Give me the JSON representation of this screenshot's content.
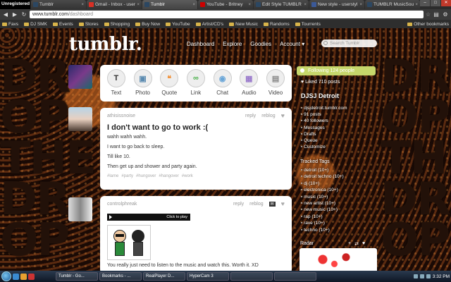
{
  "browser": {
    "hypercam_title": "Unregistered HyperCam 3",
    "tabs": [
      {
        "label": "Tumblr",
        "color": "#2c4762",
        "active": false
      },
      {
        "label": "Gmail - Inbox - userst",
        "color": "#d93025",
        "active": false
      },
      {
        "label": "Tumblr",
        "color": "#2c4762",
        "active": true
      },
      {
        "label": "YouTube - Britney",
        "color": "#cc0000",
        "active": false
      },
      {
        "label": "Edit Style TUMBLR",
        "color": "#2c4762",
        "active": false
      },
      {
        "label": "New style - userstyl",
        "color": "#3b5998",
        "active": false
      },
      {
        "label": "TUMBLR MusicSoun",
        "color": "#2c4762",
        "active": false
      }
    ],
    "url_host": "www.tumblr.com",
    "url_path": "/dashboard",
    "bookmarks": [
      "Favs",
      "DJ SMK",
      "Events",
      "Stores",
      "Shopping",
      "Buy Now",
      "YouTube",
      "Artist/CD's",
      "New Music",
      "Randoms",
      "Tourrents"
    ],
    "other_bookmarks": "Other bookmarks"
  },
  "tumblr": {
    "logo": "tumblr.",
    "nav": [
      "Dashboard",
      "Explore",
      "Goodies",
      "Account ▾"
    ],
    "search_placeholder": "Search Tumblr",
    "background_words": "DROP THE DROP THE DROP"
  },
  "post_types": [
    {
      "label": "Text",
      "icon": "text-icon",
      "glyph": "T",
      "color": "#333"
    },
    {
      "label": "Photo",
      "icon": "photo-icon",
      "glyph": "▣",
      "color": "#5a8ab0"
    },
    {
      "label": "Quote",
      "icon": "quote-icon",
      "glyph": "❝",
      "color": "#f0913a"
    },
    {
      "label": "Link",
      "icon": "link-icon",
      "glyph": "∞",
      "color": "#4ab04a"
    },
    {
      "label": "Chat",
      "icon": "chat-icon",
      "glyph": "◉",
      "color": "#6aa6d8"
    },
    {
      "label": "Audio",
      "icon": "audio-icon",
      "glyph": "▦",
      "color": "#9a7acc"
    },
    {
      "label": "Video",
      "icon": "video-icon",
      "glyph": "▤",
      "color": "#888"
    }
  ],
  "posts": [
    {
      "author": "athisissnoise",
      "reply": "reply",
      "reblog": "reblog",
      "title": "I don't want to go to work :(",
      "lines": [
        "wahh wahh wahh.",
        "I want to go back to sleep.",
        "Till like 10.",
        "Then get up and shower and party again."
      ],
      "tags": [
        "#lame",
        "#party",
        "#hungover",
        "#hangover",
        "#work"
      ]
    },
    {
      "author": "controlphreak",
      "reply": "reply",
      "reblog": "reblog",
      "player_label": "Click to play",
      "text": "You really just need to listen to the music and watch this.  Worth it. XD"
    }
  ],
  "sidebar": {
    "following": "Following 124 people",
    "liked": "Liked 710 posts",
    "blog_name": "DJSJ Detroit",
    "blog_items": [
      "djsjdetroit.tumblr.com",
      "91 posts",
      "40 followers",
      "Messages",
      "Drafts",
      "Queue",
      "Customize"
    ],
    "tracked_header": "Tracked Tags",
    "tracked_tags": [
      "detroit (10+)",
      "detroit techno (10+)",
      "dj (10+)",
      "electronica (10+)",
      "music (10+)",
      "new artist (10+)",
      "new music (10+)",
      "rap (10+)",
      "rave (10+)",
      "techno (10+)"
    ],
    "radar": "Radar"
  },
  "taskbar": {
    "buttons": [
      "Tumblr - Go...",
      "Bookmarks - ...",
      "RealPlayer D...",
      "HyperCam 3",
      "",
      ""
    ],
    "clock": "3:32 PM"
  }
}
